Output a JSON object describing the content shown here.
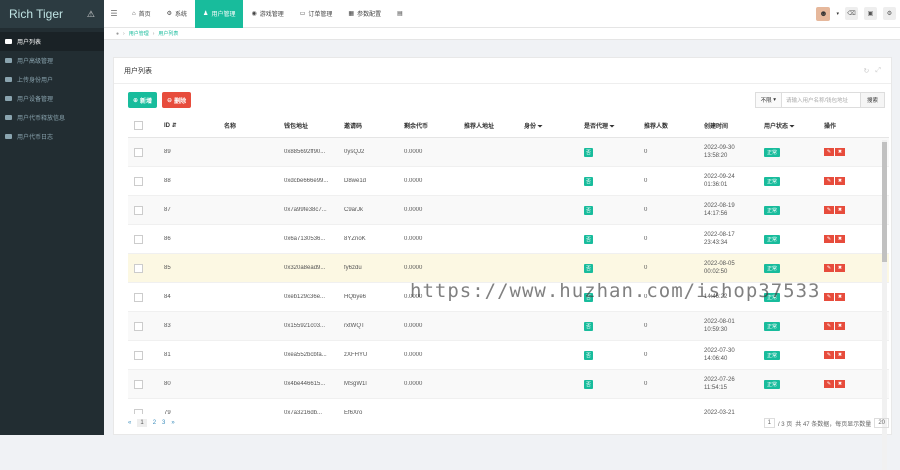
{
  "app": {
    "title": "Rich Tiger"
  },
  "sidebar": {
    "items": [
      {
        "label": "用户列表",
        "active": true
      },
      {
        "label": "用户高级管理",
        "active": false
      },
      {
        "label": "上传身份用户",
        "active": false
      },
      {
        "label": "用户设备管理",
        "active": false
      },
      {
        "label": "用户代币释放信息",
        "active": false
      },
      {
        "label": "用户代币日志",
        "active": false
      }
    ]
  },
  "topnav": {
    "tabs": [
      {
        "label": "首页",
        "icon": "home-icon",
        "active": false
      },
      {
        "label": "系统",
        "icon": "gear-icon",
        "active": false
      },
      {
        "label": "用户管理",
        "icon": "user-icon",
        "active": true
      },
      {
        "label": "游戏管理",
        "icon": "game-icon",
        "active": false
      },
      {
        "label": "订单管理",
        "icon": "order-icon",
        "active": false
      },
      {
        "label": "参数配置",
        "icon": "config-icon",
        "active": false
      }
    ]
  },
  "breadcrumb": [
    "用户管理",
    "用户列表"
  ],
  "panel": {
    "title": "用户列表"
  },
  "toolbar": {
    "add_label": "新增",
    "delete_label": "删除"
  },
  "search": {
    "dropdown": "不限",
    "placeholder": "请输入用户名称/钱包地址",
    "button": "搜索"
  },
  "table": {
    "columns": [
      "ID",
      "名称",
      "钱包地址",
      "邀请码",
      "剩余代币",
      "推荐人地址",
      "身份",
      "是否代理",
      "推荐人数",
      "创建时间",
      "用户状态",
      "操作"
    ],
    "rows": [
      {
        "id": "89",
        "name": "",
        "wallet": "0x885692ff90...",
        "code": "0ysQJ2",
        "tokens": "0.0000",
        "ref": "",
        "identity": "",
        "agent": "否",
        "refcount": "0",
        "created": "2022-09-30\n13:58:20",
        "status": "正常"
      },
      {
        "id": "88",
        "name": "",
        "wallet": "0xdcbe666e99...",
        "code": "D8we1d",
        "tokens": "0.0000",
        "ref": "",
        "identity": "",
        "agent": "否",
        "refcount": "0",
        "created": "2022-09-24\n01:36:01",
        "status": "正常"
      },
      {
        "id": "87",
        "name": "",
        "wallet": "0x7a99fe38c7...",
        "code": "C9arJk",
        "tokens": "0.0000",
        "ref": "",
        "identity": "",
        "agent": "否",
        "refcount": "0",
        "created": "2022-08-19\n14:17:56",
        "status": "正常"
      },
      {
        "id": "86",
        "name": "",
        "wallet": "0x6a7130536...",
        "code": "8YZnoK",
        "tokens": "0.0000",
        "ref": "",
        "identity": "",
        "agent": "否",
        "refcount": "0",
        "created": "2022-08-17\n23:43:34",
        "status": "正常"
      },
      {
        "id": "85",
        "name": "",
        "wallet": "0x320a8ead9...",
        "code": "fy6zdu",
        "tokens": "0.0000",
        "ref": "",
        "identity": "",
        "agent": "否",
        "refcount": "0",
        "created": "2022-08-05\n00:02:50",
        "status": "正常"
      },
      {
        "id": "84",
        "name": "",
        "wallet": "0xeb129c36e...",
        "code": "HQbye6",
        "tokens": "0.0000",
        "ref": "",
        "identity": "",
        "agent": "否",
        "refcount": "0",
        "created": "14:46:22",
        "status": "正常"
      },
      {
        "id": "83",
        "name": "",
        "wallet": "0x155921c03...",
        "code": "rxtWQT",
        "tokens": "0.0000",
        "ref": "",
        "identity": "",
        "agent": "否",
        "refcount": "0",
        "created": "2022-08-01\n10:59:30",
        "status": "正常"
      },
      {
        "id": "81",
        "name": "",
        "wallet": "0xea552bcbfa...",
        "code": "zXFHYU",
        "tokens": "0.0000",
        "ref": "",
        "identity": "",
        "agent": "否",
        "refcount": "0",
        "created": "2022-07-30\n14:06:40",
        "status": "正常"
      },
      {
        "id": "80",
        "name": "",
        "wallet": "0x4be446615...",
        "code": "MSgW1l",
        "tokens": "0.0000",
        "ref": "",
        "identity": "",
        "agent": "否",
        "refcount": "0",
        "created": "2022-07-26\n11:54:15",
        "status": "正常"
      },
      {
        "id": "79",
        "name": "",
        "wallet": "0x7a3216db...",
        "code": "Ef6Xro",
        "tokens": "",
        "ref": "",
        "identity": "",
        "agent": "",
        "refcount": "",
        "created": "2022-03-21",
        "status": ""
      }
    ]
  },
  "pagination": {
    "pages": [
      "«",
      "1",
      "2",
      "3",
      "»"
    ],
    "current": "1",
    "page_input": "1",
    "total_pages": "/ 3 页",
    "total_text": "共 47 条数据，每页显示数量",
    "per_page": "20"
  },
  "watermark": "https://www.huzhan.com/ishop37533",
  "colors": {
    "accent": "#18bc9c",
    "danger": "#e74c3c",
    "sidebar": "#222d32"
  }
}
